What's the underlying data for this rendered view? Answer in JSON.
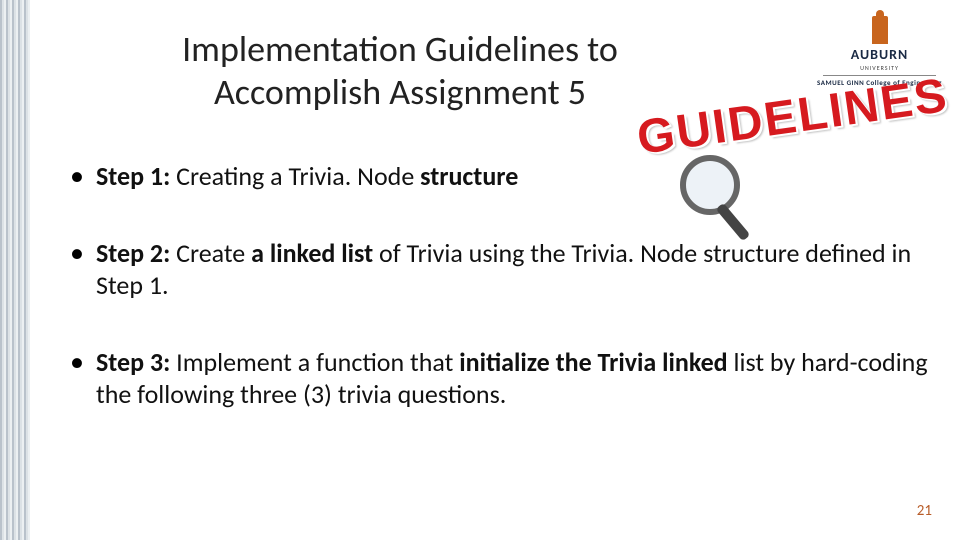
{
  "title": "Implementation Guidelines to Accomplish Assignment 5",
  "logo": {
    "name": "AUBURN",
    "sub1": "UNIVERSITY",
    "sub2": "SAMUEL GINN College of Engineering"
  },
  "art_text": "GUIDELINES",
  "steps": [
    {
      "label": "Step 1:",
      "pre": " Creating a Trivia. Node ",
      "bold": "structure",
      "post": ""
    },
    {
      "label": "Step 2:",
      "pre": " Create ",
      "bold": "a linked list",
      "post": " of Trivia using the Trivia. Node structure defined in Step 1."
    },
    {
      "label": "Step 3:",
      "pre": " Implement a function that ",
      "bold": "initialize the Trivia linked",
      "post": " list by hard-coding the following three (3) trivia questions."
    }
  ],
  "slide_number": "21"
}
